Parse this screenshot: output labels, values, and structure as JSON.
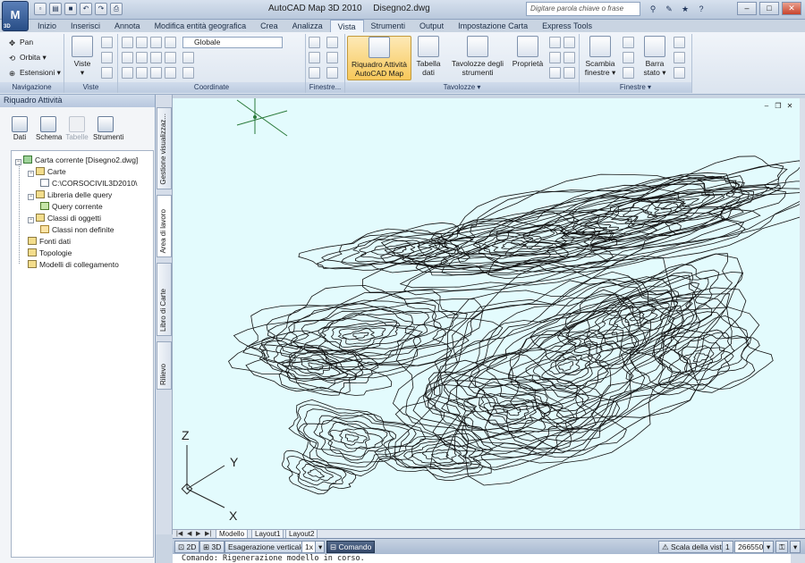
{
  "title_bar": {
    "app_button_label": "M",
    "app_button_sub": "3D",
    "app_title": "AutoCAD Map 3D 2010",
    "doc_title": "Disegno2.dwg",
    "search_placeholder": "Digitare parola chiave o frase",
    "qat_icons": [
      "new-icon",
      "open-icon",
      "save-icon",
      "undo-icon",
      "redo-icon",
      "print-icon"
    ],
    "help_icons": [
      "binoculars-icon",
      "infocenter-icon",
      "star-icon",
      "help-icon"
    ]
  },
  "menu_tabs": [
    {
      "label": "Inizio"
    },
    {
      "label": "Inserisci"
    },
    {
      "label": "Annota"
    },
    {
      "label": "Modifica entità geografica"
    },
    {
      "label": "Crea"
    },
    {
      "label": "Analizza"
    },
    {
      "label": "Vista",
      "active": true
    },
    {
      "label": "Strumenti"
    },
    {
      "label": "Output"
    },
    {
      "label": "Impostazione Carta"
    },
    {
      "label": "Express Tools"
    }
  ],
  "ribbon": {
    "navigazione": {
      "title": "Navigazione",
      "pan": "Pan",
      "orbita": "Orbita",
      "estensioni": "Estensioni"
    },
    "viste": {
      "title": "Viste",
      "viste_label": "Viste"
    },
    "coordinate": {
      "title": "Coordinate",
      "ucs_combo": "Globale"
    },
    "finestre1": {
      "title": "Finestre..."
    },
    "tavolozze": {
      "title": "Tavolozze",
      "riquadro_line1": "Riquadro Attività",
      "riquadro_line2": "AutoCAD Map",
      "tabella_line1": "Tabella",
      "tabella_line2": "dati",
      "tavolozze_line1": "Tavolozze degli",
      "tavolozze_line2": "strumenti",
      "proprieta": "Proprietà"
    },
    "finestre2": {
      "title": "Finestre",
      "scambia_line1": "Scambia",
      "scambia_line2": "finestre",
      "barra_line1": "Barra",
      "barra_line2": "stato"
    }
  },
  "palette": {
    "title": "Riquadro Attività",
    "tools": [
      {
        "label": "Dati",
        "disabled": false
      },
      {
        "label": "Schema",
        "disabled": false
      },
      {
        "label": "Tabelle",
        "disabled": true
      },
      {
        "label": "Strumenti",
        "disabled": false
      }
    ],
    "tree": [
      {
        "label": "Carta corrente [Disegno2.dwg]"
      },
      {
        "label": "Carte"
      },
      {
        "label": "C:\\CORSOCIVIL3D2010\\"
      },
      {
        "label": "Libreria delle query"
      },
      {
        "label": "Query corrente"
      },
      {
        "label": "Classi di oggetti"
      },
      {
        "label": "Classi non definite"
      },
      {
        "label": "Fonti dati"
      },
      {
        "label": "Topologie"
      },
      {
        "label": "Modelli di collegamento"
      }
    ]
  },
  "side_tabs": [
    {
      "label": "Gestione visualizzaz..."
    },
    {
      "label": "Area di lavoro",
      "active": true
    },
    {
      "label": "Libro di Carte"
    },
    {
      "label": "Rilievo"
    }
  ],
  "viewport": {
    "background": "#e3fbfd",
    "axes": {
      "x": "X",
      "y": "Y",
      "z": "Z"
    }
  },
  "layout_tabs": [
    {
      "label": "Modello",
      "active": true
    },
    {
      "label": "Layout1"
    },
    {
      "label": "Layout2"
    }
  ],
  "status_bar": {
    "btn_2d": "2D",
    "btn_3d": "3D",
    "exaggeration_label": "Esagerazione verticale:",
    "exaggeration_value": "1x",
    "comando": "Comando",
    "scala_label": "Scala della vista",
    "scala_value": "1",
    "scale_number": "266550"
  },
  "command_line": {
    "text": "Comando: Rigenerazione modello in corso."
  }
}
